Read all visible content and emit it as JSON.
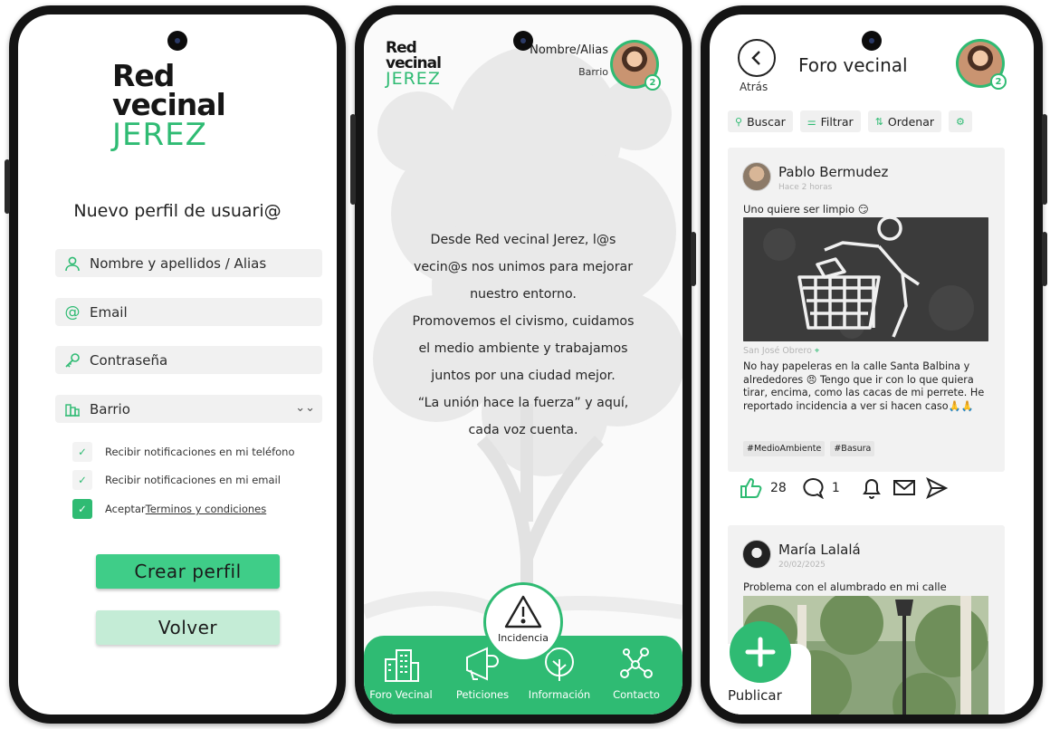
{
  "brand": {
    "line1": "Red",
    "line2": "vecinal",
    "line3": "JEREZ",
    "accent": "#2fbb73"
  },
  "register": {
    "title": "Nuevo perfil de usuari@",
    "fields": {
      "name": "Nombre y apellidos / Alias",
      "email": "Email",
      "password": "Contraseña",
      "barrio": "Barrio"
    },
    "checks": {
      "phone": "Recibir notificaciones en mi teléfono",
      "email": "Recibir notificaciones en mi email",
      "terms_pre": "Aceptar ",
      "terms_link": "Terminos y condiciones"
    },
    "create_label": "Crear perfil",
    "back_label": "Volver"
  },
  "home": {
    "user_name": "Nombre/Alias",
    "user_barrio": "Barrio",
    "badge": "2",
    "mission": [
      "Desde Red vecinal Jerez, l@s",
      "vecin@s nos unimos para mejorar",
      "nuestro entorno.",
      "Promovemos el civismo, cuidamos",
      "el medio ambiente y trabajamos",
      "juntos por una ciudad mejor.",
      "“La unión hace la fuerza” y aquí,",
      "cada voz cuenta."
    ],
    "incident_label": "Incidencia",
    "nav": [
      "Foro Vecinal",
      "Peticiones",
      "Información",
      "Contacto"
    ]
  },
  "forum": {
    "back_label": "Atrás",
    "title": "Foro vecinal",
    "badge": "2",
    "toolbar": {
      "search": "Buscar",
      "filter": "Filtrar",
      "sort": "Ordenar"
    },
    "post1": {
      "author": "Pablo Bermudez",
      "time": "Hace 2 horas",
      "title": "Uno quiere ser limpio 😏",
      "location": "San José Obrero",
      "body": "No hay papeleras en la calle Santa Balbina y alrededores 😠 Tengo que ir con lo que quiera tirar, encima, como las cacas de mi perrete. He reportado incidencia a ver si hacen caso🙏🙏",
      "tags": [
        "#MedioAmbiente",
        "#Basura"
      ],
      "likes": "28",
      "comments": "1"
    },
    "post2": {
      "author": "María Lalalá",
      "time": "20/02/2025",
      "title": "Problema con el alumbrado en mi calle"
    },
    "publish_label": "Publicar"
  }
}
